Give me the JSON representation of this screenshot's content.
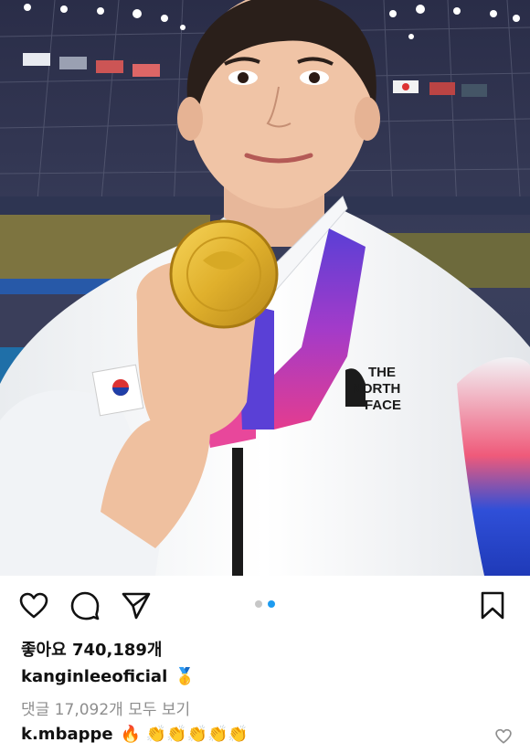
{
  "post": {
    "image_alt": "Selfie of a smiling athlete holding a gold medal in a stadium at night",
    "jacket_logo_text": "THE NORTH FACE"
  },
  "actions": {
    "like_icon": "heart-icon",
    "comment_icon": "comment-icon",
    "share_icon": "send-icon",
    "save_icon": "bookmark-icon"
  },
  "carousel": {
    "total": 2,
    "active_index": 1,
    "active_color": "#1d9bf0",
    "inactive_color": "#c7c7c7"
  },
  "likes": {
    "text": "좋아요 740,189개"
  },
  "caption": {
    "username": "kanginleeoficial",
    "text": "🥇"
  },
  "comments": {
    "view_all_text": "댓글 17,092개 모두 보기"
  },
  "top_comment": {
    "username": "k.mbappe",
    "text": "🔥 👏👏👏👏👏"
  }
}
